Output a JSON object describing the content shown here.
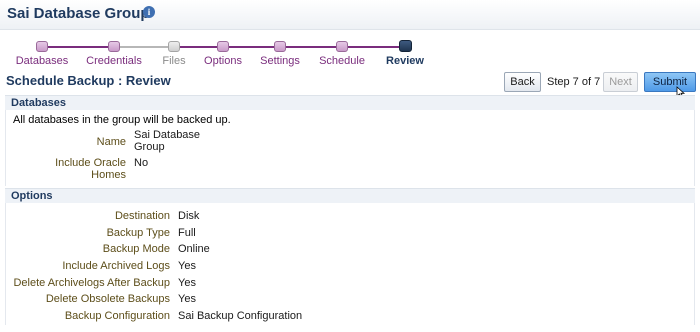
{
  "header": {
    "title": "Sai Database Group",
    "info_icon": "info-icon"
  },
  "train": {
    "stops": [
      {
        "label": "Databases",
        "state": "visited"
      },
      {
        "label": "Credentials",
        "state": "visited"
      },
      {
        "label": "Files",
        "state": "disabled"
      },
      {
        "label": "Options",
        "state": "visited"
      },
      {
        "label": "Settings",
        "state": "visited"
      },
      {
        "label": "Schedule",
        "state": "visited"
      },
      {
        "label": "Review",
        "state": "current"
      }
    ]
  },
  "page": {
    "title": "Schedule Backup : Review"
  },
  "nav": {
    "back_label": "Back",
    "step_text": "Step 7 of 7",
    "next_label": "Next",
    "submit_label": "Submit"
  },
  "databases_section": {
    "title": "Databases",
    "description": "All databases in the group will be backed up.",
    "name_label": "Name",
    "name_value_line1": "Sai Database",
    "name_value_line2": "Group",
    "include_oracle_label_line1": "Include Oracle",
    "include_oracle_label_line2": "Homes",
    "include_oracle_value": "No"
  },
  "options_section": {
    "title": "Options",
    "rows": [
      {
        "label": "Destination",
        "value": "Disk"
      },
      {
        "label": "Backup Type",
        "value": "Full"
      },
      {
        "label": "Backup Mode",
        "value": "Online"
      },
      {
        "label": "Include Archived Logs",
        "value": "Yes"
      },
      {
        "label": "Delete Archivelogs After Backup",
        "value": "Yes"
      },
      {
        "label": "Delete Obsolete Backups",
        "value": "Yes"
      },
      {
        "label": "Backup Configuration",
        "value": "Sai Backup Configuration"
      }
    ]
  },
  "colors": {
    "accent": "#7a2d7d",
    "title": "#1f3a5f",
    "label": "#5d4e1a",
    "primary_button": "#4f9ae8"
  }
}
